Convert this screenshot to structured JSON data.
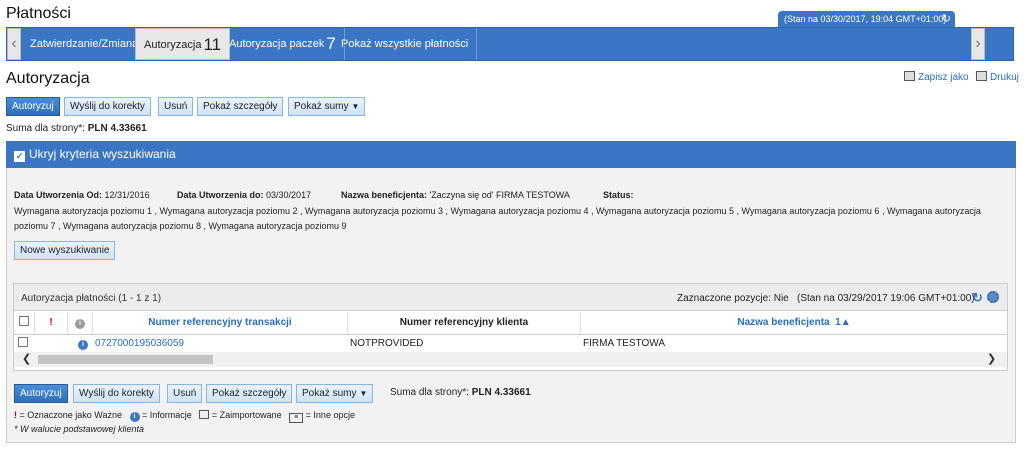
{
  "page_title": "Płatności",
  "stan_top": "(Stan na 03/30/2017, 19:04 GMT+01:00)",
  "tabs": [
    {
      "label": "Zatwierdzanie/Zmiana",
      "count": ""
    },
    {
      "label": "Autoryzacja",
      "count": "11"
    },
    {
      "label": "Autoryzacja paczek",
      "count": "7"
    },
    {
      "label": "Pokaż wszystkie płatności",
      "count": ""
    }
  ],
  "section_title": "Autoryzacja",
  "save_as": "Zapisz jako",
  "print": "Drukuj",
  "toolbar": {
    "authorize": "Autoryzuj",
    "send_back": "Wyślij do korekty",
    "delete": "Usuń",
    "details": "Pokaż szczegóły",
    "sums": "Pokaż sumy"
  },
  "suma_label": "Suma dla strony*:",
  "suma_value": "PLN 4.33661",
  "criteria_header": "Ukryj kryteria wyszukiwania",
  "criteria": {
    "date_from_label": "Data Utworzenia Od:",
    "date_from": "12/31/2016",
    "date_to_label": "Data Utworzenia do:",
    "date_to": "03/30/2017",
    "beneficiary_label": "Nazwa beneficjenta:",
    "beneficiary": "'Zaczyna się od' FIRMA TESTOWA",
    "status_label": "Status:",
    "status_line1": "Wymagana autoryzacja poziomu 1 , Wymagana autoryzacja poziomu 2 , Wymagana autoryzacja poziomu 3 , Wymagana autoryzacja poziomu 4 , Wymagana autoryzacja poziomu 5 , Wymagana autoryzacja poziomu 6 , Wymagana autoryzacja",
    "status_line2": "poziomu 7 , Wymagana autoryzacja poziomu 8 , Wymagana autoryzacja poziomu 9"
  },
  "new_search": "Nowe wyszukiwanie",
  "grid": {
    "title": "Autoryzacja płatności (1 - 1 z 1)",
    "selected": "Zaznaczone pozycje: Nie",
    "stan": "(Stan na 03/29/2017 19:06 GMT+01:00)",
    "columns": [
      "Numer referencyjny transakcji",
      "Numer referencyjny klienta",
      "Nazwa beneficjenta"
    ],
    "sort_indicator": "1▲",
    "rows": [
      {
        "ref": "0727000195036059",
        "client_ref": "NOTPROVIDED",
        "beneficiary": "FIRMA TESTOWA"
      }
    ]
  },
  "legend": {
    "important": "= Oznaczone jako Ważne",
    "info": "= Informacje",
    "imported": "= Zaimportowane",
    "other": "= Inne opcje",
    "footnote": "* W walucie podstawowej klienta"
  },
  "colors": {
    "accent": "#3a76c3",
    "link": "#2a6ebb",
    "important": "#d00000"
  }
}
